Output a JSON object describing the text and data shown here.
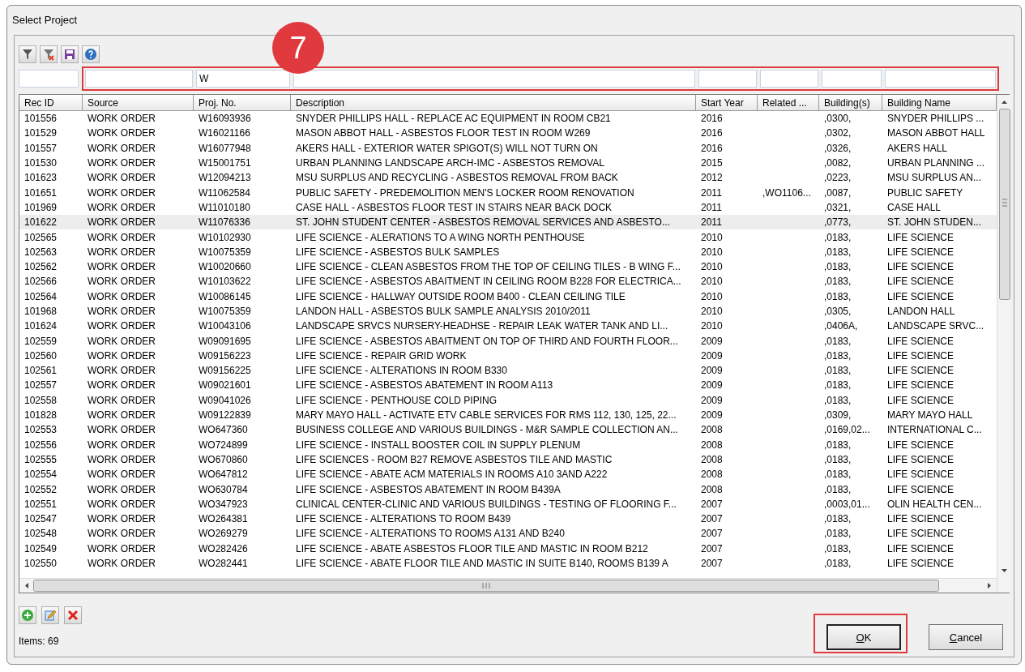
{
  "window": {
    "title": "Select Project"
  },
  "annotation": {
    "badge": "7"
  },
  "table": {
    "columns": [
      {
        "label": "Rec ID"
      },
      {
        "label": "Source"
      },
      {
        "label": "Proj. No.",
        "filter": "W"
      },
      {
        "label": "Description"
      },
      {
        "label": "Start Year"
      },
      {
        "label": "Related ..."
      },
      {
        "label": "Building(s)"
      },
      {
        "label": "Building Name"
      }
    ],
    "rows": [
      {
        "selected": false,
        "cells": [
          "101556",
          "WORK ORDER",
          "W16093936",
          "SNYDER PHILLIPS HALL - REPLACE AC EQUIPMENT IN ROOM CB21",
          "2016",
          "",
          ",0300,",
          "SNYDER PHILLIPS ..."
        ]
      },
      {
        "selected": false,
        "cells": [
          "101529",
          "WORK ORDER",
          "W16021166",
          "MASON ABBOT HALL - ASBESTOS FLOOR TEST IN  ROOM W269",
          "2016",
          "",
          ",0302,",
          "MASON ABBOT HALL"
        ]
      },
      {
        "selected": false,
        "cells": [
          "101557",
          "WORK ORDER",
          "W16077948",
          "AKERS HALL - EXTERIOR WATER SPIGOT(S) WILL NOT TURN ON",
          "2016",
          "",
          ",0326,",
          "AKERS HALL"
        ]
      },
      {
        "selected": false,
        "cells": [
          "101530",
          "WORK ORDER",
          "W15001751",
          "URBAN PLANNING LANDSCAPE ARCH-IMC - ASBESTOS REMOVAL",
          "2015",
          "",
          ",0082,",
          "URBAN PLANNING ..."
        ]
      },
      {
        "selected": false,
        "cells": [
          "101623",
          "WORK ORDER",
          "W12094213",
          "MSU SURPLUS AND RECYCLING - ASBESTOS REMOVAL FROM BACK",
          "2012",
          "",
          ",0223,",
          "MSU SURPLUS AN..."
        ]
      },
      {
        "selected": false,
        "cells": [
          "101651",
          "WORK ORDER",
          "W11062584",
          "PUBLIC SAFETY - PREDEMOLITION MEN'S LOCKER ROOM RENOVATION",
          "2011",
          ",WO1106...",
          ",0087,",
          "PUBLIC SAFETY"
        ]
      },
      {
        "selected": false,
        "cells": [
          "101969",
          "WORK ORDER",
          "W11010180",
          "CASE HALL - ASBESTOS FLOOR TEST IN STAIRS NEAR BACK DOCK",
          "2011",
          "",
          ",0321,",
          "CASE HALL"
        ]
      },
      {
        "selected": true,
        "cells": [
          "101622",
          "WORK ORDER",
          "W11076336",
          "ST. JOHN STUDENT CENTER - ASBESTOS REMOVAL SERVICES AND ASBESTO...",
          "2011",
          "",
          ",0773,",
          "ST. JOHN STUDEN..."
        ]
      },
      {
        "selected": false,
        "cells": [
          "102565",
          "WORK ORDER",
          "W10102930",
          "LIFE SCIENCE -  ALERATIONS TO A WING NORTH PENTHOUSE",
          "2010",
          "",
          ",0183,",
          "LIFE SCIENCE"
        ]
      },
      {
        "selected": false,
        "cells": [
          "102563",
          "WORK ORDER",
          "W10075359",
          "LIFE SCIENCE - ASBESTOS BULK SAMPLES",
          "2010",
          "",
          ",0183,",
          "LIFE SCIENCE"
        ]
      },
      {
        "selected": false,
        "cells": [
          "102562",
          "WORK ORDER",
          "W10020660",
          "LIFE SCIENCE - CLEAN ASBESTOS FROM THE TOP OF CEILING TILES - B WING F...",
          "2010",
          "",
          ",0183,",
          "LIFE SCIENCE"
        ]
      },
      {
        "selected": false,
        "cells": [
          "102566",
          "WORK ORDER",
          "W10103622",
          "LIFE SCIENCE - ASBESTOS ABAITMENT IN CEILING ROOM B228 FOR ELECTRICA...",
          "2010",
          "",
          ",0183,",
          "LIFE SCIENCE"
        ]
      },
      {
        "selected": false,
        "cells": [
          "102564",
          "WORK ORDER",
          "W10086145",
          "LIFE SCIENCE - HALLWAY OUTSIDE ROOM B400 - CLEAN CEILING TILE",
          "2010",
          "",
          ",0183,",
          "LIFE SCIENCE"
        ]
      },
      {
        "selected": false,
        "cells": [
          "101968",
          "WORK ORDER",
          "W10075359",
          "LANDON HALL - ASBESTOS BULK SAMPLE ANALYSIS 2010/2011",
          "2010",
          "",
          ",0305,",
          "LANDON HALL"
        ]
      },
      {
        "selected": false,
        "cells": [
          "101624",
          "WORK ORDER",
          "W10043106",
          "LANDSCAPE SRVCS NURSERY-HEADHSE - REPAIR LEAK WATER TANK AND LI...",
          "2010",
          "",
          ",0406A,",
          "LANDSCAPE SRVC..."
        ]
      },
      {
        "selected": false,
        "cells": [
          "102559",
          "WORK ORDER",
          "W09091695",
          "LIFE SCIENCE - ASBESTOS ABAITMENT ON TOP OF THIRD AND FOURTH FLOOR...",
          "2009",
          "",
          ",0183,",
          "LIFE SCIENCE"
        ]
      },
      {
        "selected": false,
        "cells": [
          "102560",
          "WORK ORDER",
          "W09156223",
          "LIFE SCIENCE - REPAIR GRID WORK",
          "2009",
          "",
          ",0183,",
          "LIFE SCIENCE"
        ]
      },
      {
        "selected": false,
        "cells": [
          "102561",
          "WORK ORDER",
          "W09156225",
          "LIFE SCIENCE - ALTERATIONS IN ROOM B330",
          "2009",
          "",
          ",0183,",
          "LIFE SCIENCE"
        ]
      },
      {
        "selected": false,
        "cells": [
          "102557",
          "WORK ORDER",
          "W09021601",
          "LIFE SCIENCE - ASBESTOS ABATEMENT IN ROOM A113",
          "2009",
          "",
          ",0183,",
          "LIFE SCIENCE"
        ]
      },
      {
        "selected": false,
        "cells": [
          "102558",
          "WORK ORDER",
          "W09041026",
          "LIFE SCIENCE - PENTHOUSE COLD PIPING",
          "2009",
          "",
          ",0183,",
          "LIFE SCIENCE"
        ]
      },
      {
        "selected": false,
        "cells": [
          "101828",
          "WORK ORDER",
          "W09122839",
          "MARY MAYO HALL - ACTIVATE ETV CABLE SERVICES FOR RMS 112, 130, 125, 22...",
          "2009",
          "",
          ",0309,",
          "MARY MAYO HALL"
        ]
      },
      {
        "selected": false,
        "cells": [
          "102553",
          "WORK ORDER",
          "WO647360",
          "BUSINESS COLLEGE AND VARIOUS BUILDINGS - M&R SAMPLE COLLECTION AN...",
          "2008",
          "",
          ",0169,02...",
          "INTERNATIONAL C..."
        ]
      },
      {
        "selected": false,
        "cells": [
          "102556",
          "WORK ORDER",
          "WO724899",
          "LIFE SCIENCE - INSTALL BOOSTER COIL IN SUPPLY PLENUM",
          "2008",
          "",
          ",0183,",
          "LIFE SCIENCE"
        ]
      },
      {
        "selected": false,
        "cells": [
          "102555",
          "WORK ORDER",
          "WO670860",
          "LIFE SCIENCES - ROOM B27 REMOVE ASBESTOS TILE AND MASTIC",
          "2008",
          "",
          ",0183,",
          "LIFE SCIENCE"
        ]
      },
      {
        "selected": false,
        "cells": [
          "102554",
          "WORK ORDER",
          "WO647812",
          "LIFE SCIENCE - ABATE ACM MATERIALS IN ROOMS A10 3AND A222",
          "2008",
          "",
          ",0183,",
          "LIFE SCIENCE"
        ]
      },
      {
        "selected": false,
        "cells": [
          "102552",
          "WORK ORDER",
          "WO630784",
          "LIFE SCIENCE - ASBESTOS ABATEMENT IN ROOM B439A",
          "2008",
          "",
          ",0183,",
          "LIFE SCIENCE"
        ]
      },
      {
        "selected": false,
        "cells": [
          "102551",
          "WORK ORDER",
          "WO347923",
          "CLINICAL CENTER-CLINIC AND VARIOUS BUILDINGS - TESTING OF FLOORING F...",
          "2007",
          "",
          ",0003,01...",
          "OLIN HEALTH CEN..."
        ]
      },
      {
        "selected": false,
        "cells": [
          "102547",
          "WORK ORDER",
          "WO264381",
          "LIFE SCIENCE - ALTERATIONS TO ROOM B439",
          "2007",
          "",
          ",0183,",
          "LIFE SCIENCE"
        ]
      },
      {
        "selected": false,
        "cells": [
          "102548",
          "WORK ORDER",
          "WO269279",
          "LIFE SCIENCE - ALTERATIONS TO ROOMS A131 AND B240",
          "2007",
          "",
          ",0183,",
          "LIFE SCIENCE"
        ]
      },
      {
        "selected": false,
        "cells": [
          "102549",
          "WORK ORDER",
          "WO282426",
          "LIFE SCIENCE - ABATE ASBESTOS FLOOR TILE AND MASTIC IN ROOM B212",
          "2007",
          "",
          ",0183,",
          "LIFE SCIENCE"
        ]
      },
      {
        "selected": false,
        "cells": [
          "102550",
          "WORK ORDER",
          "WO282441",
          "LIFE SCIENCE - ABATE FLOOR TILE AND MASTIC IN SUITE B140, ROOMS B139 A",
          "2007",
          "",
          ",0183,",
          "LIFE SCIENCE"
        ]
      }
    ]
  },
  "status": {
    "items": "Items: 69"
  },
  "buttons": [
    {
      "label": "OK",
      "highlighted": true
    },
    {
      "label": "Cancel",
      "highlighted": false
    }
  ]
}
